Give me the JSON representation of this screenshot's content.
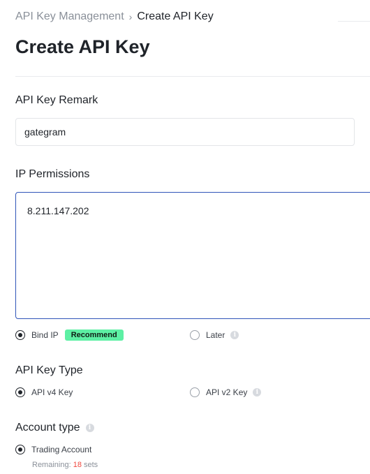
{
  "breadcrumb": {
    "parent": "API Key Management",
    "separator": "›",
    "current": "Create API Key"
  },
  "page_title": "Create API Key",
  "remark": {
    "label": "API Key Remark",
    "value": "gategram"
  },
  "ip_permissions": {
    "label": "IP Permissions",
    "value": "8.211.147.202",
    "options": [
      {
        "label": "Bind IP",
        "badge": "Recommend",
        "selected": true
      },
      {
        "label": "Later",
        "selected": false
      }
    ]
  },
  "key_type": {
    "label": "API Key Type",
    "options": [
      {
        "label": "API v4 Key",
        "selected": true
      },
      {
        "label": "API v2 Key",
        "selected": false
      }
    ]
  },
  "account_type": {
    "label": "Account type",
    "options": [
      {
        "label": "Trading Account",
        "selected": true
      }
    ],
    "remaining_prefix": "Remaining: ",
    "remaining_count": "18",
    "remaining_suffix": " sets"
  },
  "icons": {
    "info": "info-icon",
    "chevron": "chevron-right-icon"
  },
  "colors": {
    "accent_border": "#2f54b8",
    "recommend_badge": "#5df0a4",
    "remaining_count": "#f0483e"
  }
}
